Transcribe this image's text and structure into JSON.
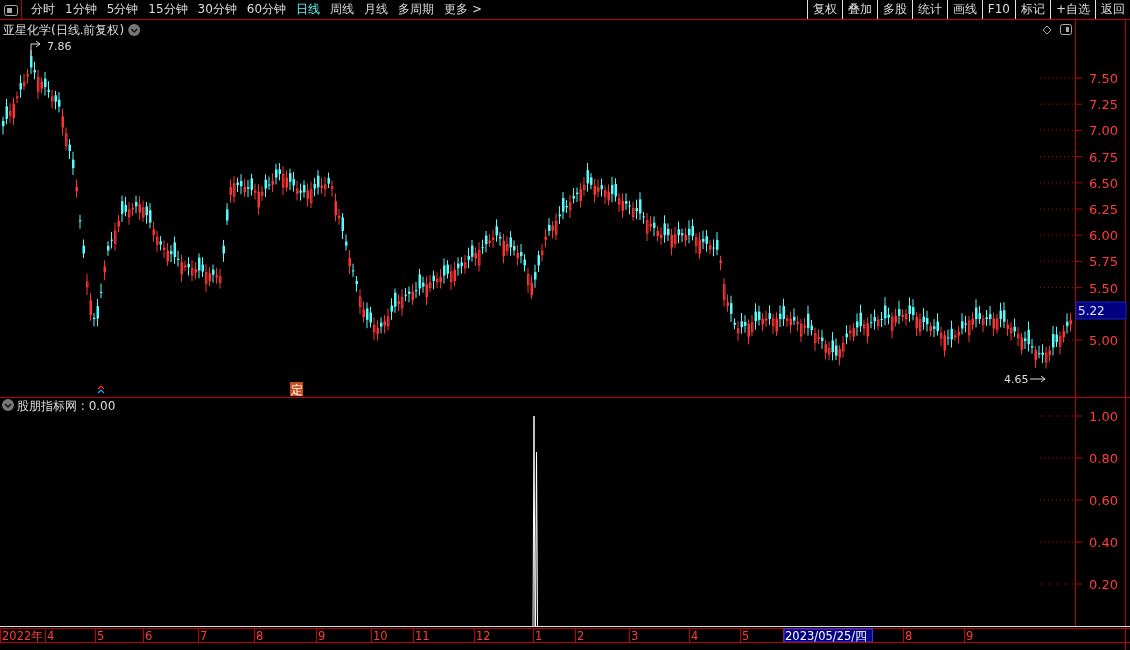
{
  "toolbar": {
    "periods": [
      {
        "label": "分时",
        "selected": false
      },
      {
        "label": "1分钟",
        "selected": false
      },
      {
        "label": "5分钟",
        "selected": false
      },
      {
        "label": "15分钟",
        "selected": false
      },
      {
        "label": "30分钟",
        "selected": false
      },
      {
        "label": "60分钟",
        "selected": false
      },
      {
        "label": "日线",
        "selected": true
      },
      {
        "label": "周线",
        "selected": false
      },
      {
        "label": "月线",
        "selected": false
      },
      {
        "label": "多周期",
        "selected": false
      },
      {
        "label": "更多 >",
        "selected": false
      }
    ],
    "buttons": [
      "复权",
      "叠加",
      "多股",
      "统计",
      "画线",
      "F10",
      "标记",
      "+自选",
      "返回"
    ]
  },
  "main_chart": {
    "title": "亚星化学(日线.前复权)",
    "high_label": "7.86",
    "low_label": "4.65",
    "current_price": "5.22",
    "price_axis": [
      "7.50",
      "7.25",
      "7.00",
      "6.75",
      "6.50",
      "6.25",
      "6.00",
      "5.75",
      "5.50",
      "5.00"
    ],
    "markers": [
      {
        "kind": "arrow"
      },
      {
        "kind": "badge",
        "label": "定"
      }
    ]
  },
  "indicator": {
    "title": "股朋指标网 : 0.00",
    "axis": [
      "1.00",
      "0.80",
      "0.60",
      "0.40",
      "0.20"
    ]
  },
  "date_axis": [
    {
      "label": "2022年",
      "selected": false
    },
    {
      "label": "4",
      "selected": false
    },
    {
      "label": "5",
      "selected": false
    },
    {
      "label": "6",
      "selected": false
    },
    {
      "label": "7",
      "selected": false
    },
    {
      "label": "8",
      "selected": false
    },
    {
      "label": "9",
      "selected": false
    },
    {
      "label": "10",
      "selected": false
    },
    {
      "label": "11",
      "selected": false
    },
    {
      "label": "12",
      "selected": false
    },
    {
      "label": "1",
      "selected": false
    },
    {
      "label": "2",
      "selected": false
    },
    {
      "label": "3",
      "selected": false
    },
    {
      "label": "4",
      "selected": false
    },
    {
      "label": "5",
      "selected": false
    },
    {
      "label": "2023/05/25/四",
      "selected": true
    },
    {
      "label": "8",
      "selected": false
    },
    {
      "label": "9",
      "selected": false
    }
  ]
}
